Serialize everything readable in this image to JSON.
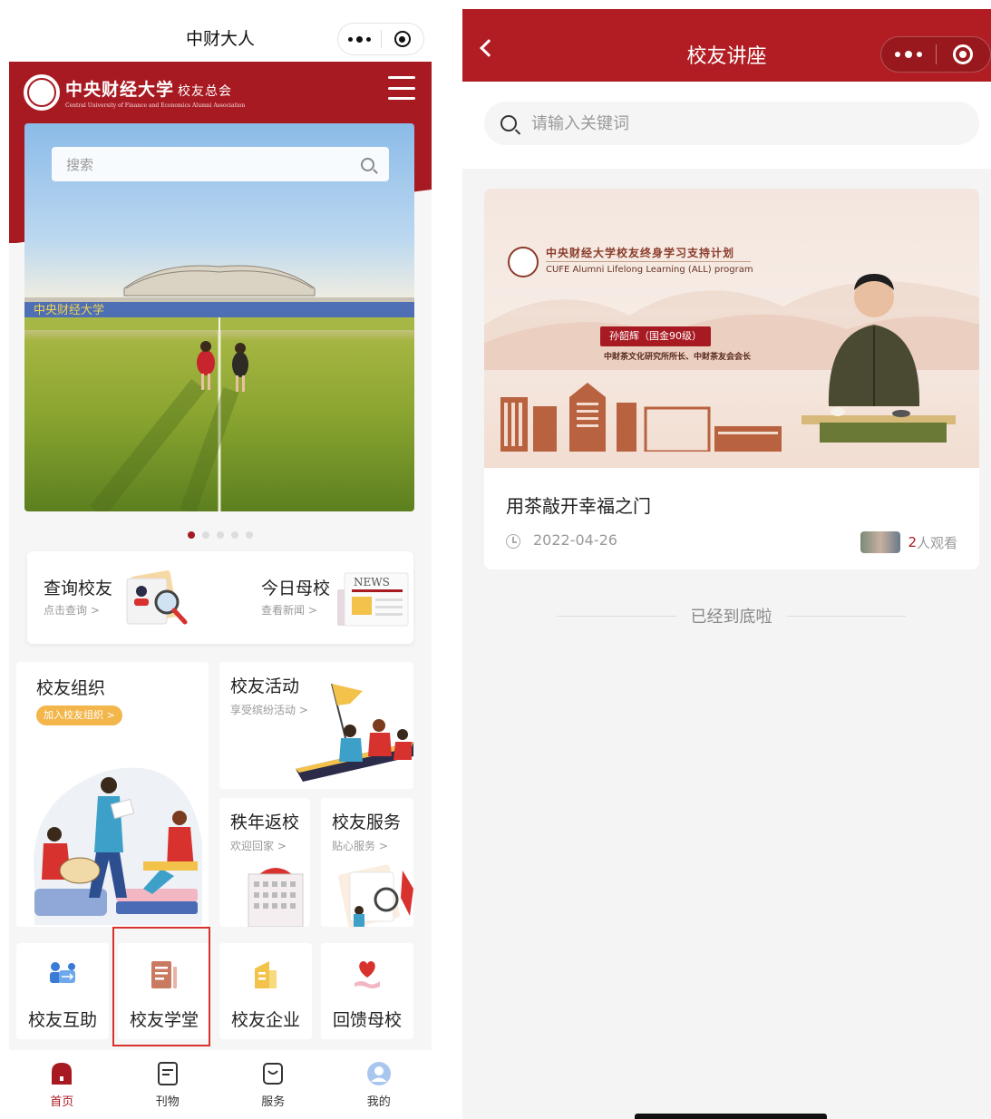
{
  "left": {
    "miniprogram_title": "中财大人",
    "header": {
      "logo_cn": "中央财经大学",
      "logo_suffix": "校友总会",
      "logo_en": "Central University of Finance and Economics Alumni Association"
    },
    "search": {
      "placeholder": "搜索"
    },
    "banner": {
      "stadium_text": "中央财经大学",
      "page_count": 5,
      "active_page": 1
    },
    "quick": [
      {
        "title": "查询校友",
        "sub": "点击查询 >"
      },
      {
        "title": "今日母校",
        "sub": "查看新闻 >",
        "news_badge": "NEWS"
      }
    ],
    "tiles": {
      "org": {
        "title": "校友组织",
        "pill": "加入校友组织 >"
      },
      "activity": {
        "title": "校友活动",
        "sub": "享受缤纷活动 >"
      },
      "return": {
        "title": "秩年返校",
        "sub": "欢迎回家 >"
      },
      "service": {
        "title": "校友服务",
        "sub": "贴心服务 >"
      }
    },
    "bottom_items": [
      {
        "label": "校友互助",
        "icon": "handshake-cards-icon"
      },
      {
        "label": "校友学堂",
        "icon": "document-icon"
      },
      {
        "label": "校友企业",
        "icon": "building-icon"
      },
      {
        "label": "回馈母校",
        "icon": "heart-hand-icon"
      }
    ],
    "tabbar": [
      {
        "label": "首页",
        "icon": "home-icon",
        "active": true
      },
      {
        "label": "刊物",
        "icon": "magazine-icon",
        "active": false
      },
      {
        "label": "服务",
        "icon": "service-bag-icon",
        "active": false
      },
      {
        "label": "我的",
        "icon": "profile-icon",
        "active": false
      }
    ],
    "colors": {
      "brand_red": "#a81a22",
      "pill_orange": "#f3b64b",
      "highlight_border": "#d8322f"
    }
  },
  "right": {
    "nav_title": "校友讲座",
    "search": {
      "placeholder": "请输入关键词"
    },
    "lecture": {
      "cover_program_cn": "中央财经大学校友终身学习支持计划",
      "cover_program_en": "CUFE Alumni Lifelong Learning (ALL) program",
      "speaker": "孙韶辉（国金90级）",
      "speaker_title": "中财茶文化研究所所长、中财茶友会会长",
      "title": "用茶敲开幸福之门",
      "date": "2022-04-26",
      "viewer_count": "2",
      "viewer_suffix": "人观看"
    },
    "end_text": "已经到底啦",
    "colors": {
      "nav_red": "#b11d22"
    }
  }
}
